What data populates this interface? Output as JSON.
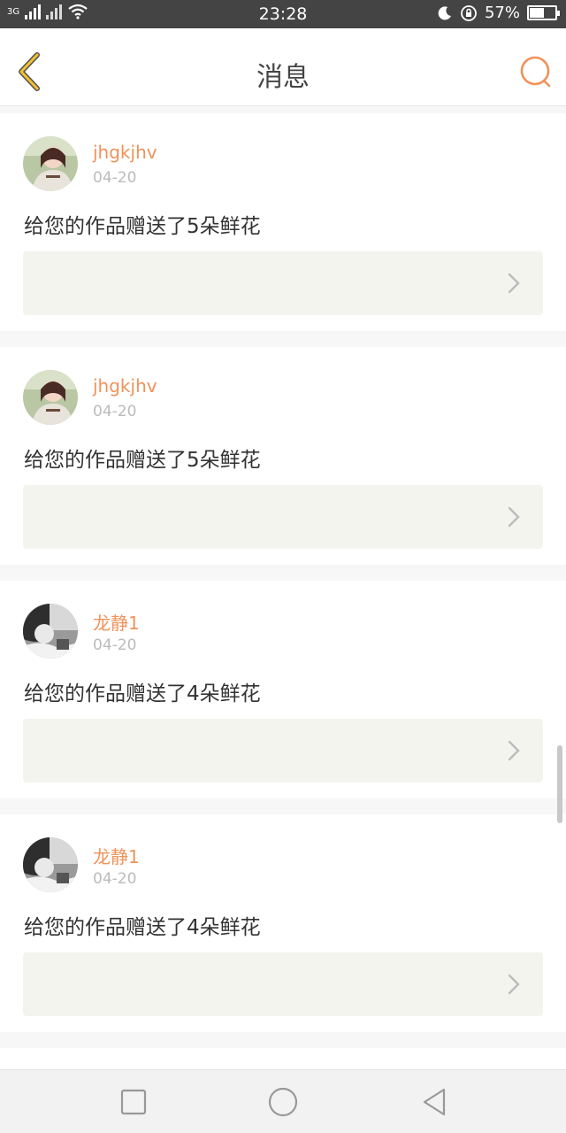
{
  "status_bar": {
    "network_label": "3G",
    "time": "23:28",
    "battery_percent_text": "57%",
    "battery_level": 0.57,
    "icons": [
      "signal-icon",
      "no-signal-icon",
      "wifi-icon",
      "moon-icon",
      "rotation-lock-icon",
      "battery-icon"
    ]
  },
  "header": {
    "title": "消息",
    "back_icon": "chevron-left-icon",
    "search_icon": "search-icon"
  },
  "colors": {
    "accent": "#f0925a",
    "back_arrow": "#f2c12e",
    "card_attachment_bg": "#f4f4ef"
  },
  "messages": [
    {
      "username": "jhgkjhv",
      "date": "04-20",
      "text": "给您的作品赠送了5朵鲜花",
      "avatar": "avatar-color"
    },
    {
      "username": "jhgkjhv",
      "date": "04-20",
      "text": "给您的作品赠送了5朵鲜花",
      "avatar": "avatar-color"
    },
    {
      "username": "龙静1",
      "date": "04-20",
      "text": "给您的作品赠送了4朵鲜花",
      "avatar": "avatar-bw"
    },
    {
      "username": "龙静1",
      "date": "04-20",
      "text": "给您的作品赠送了4朵鲜花",
      "avatar": "avatar-bw"
    }
  ],
  "nav_bar": {
    "buttons": [
      "square-icon",
      "circle-icon",
      "triangle-back-icon"
    ]
  }
}
